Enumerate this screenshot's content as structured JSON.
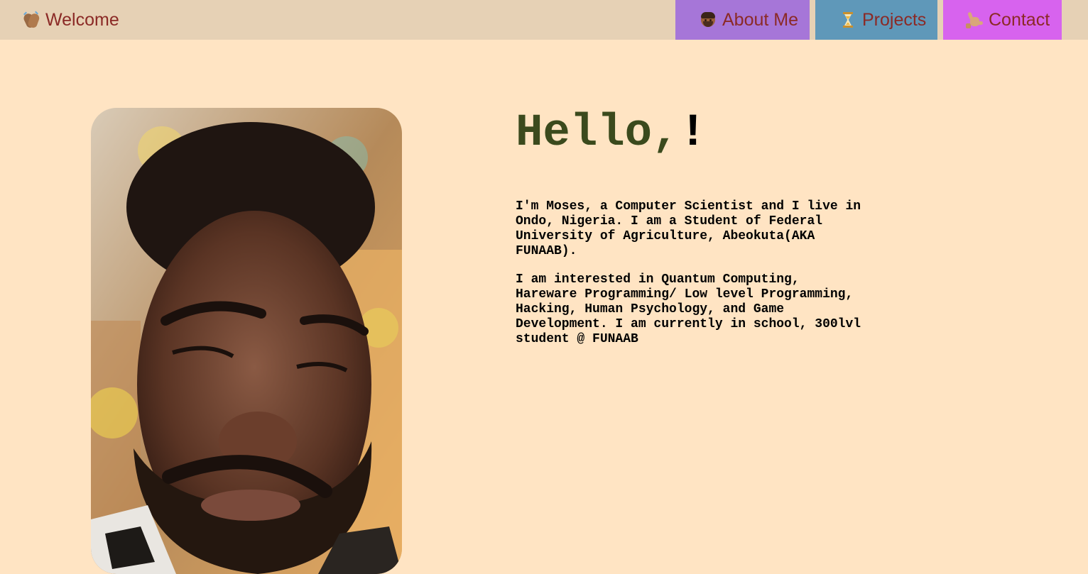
{
  "navbar": {
    "brand": {
      "icon": "clapping-hands-icon",
      "label": "Welcome"
    },
    "links": [
      {
        "icon": "person-beard-icon",
        "label": "About Me",
        "background": "#a676d8"
      },
      {
        "icon": "hourglass-icon",
        "label": "Projects",
        "background": "#5f98b9"
      },
      {
        "icon": "call-me-hand-icon",
        "label": "Contact",
        "background": "#d763ee"
      }
    ],
    "background": "#e6d1b5",
    "text_color": "#8b2a26"
  },
  "hero": {
    "greeting": "Hello,",
    "greeting_mark": "!",
    "greeting_color": "#3b4a1d",
    "paragraphs": [
      "I'm Moses, a Computer Scientist and I live in Ondo, Nigeria. I am a Student of Federal University of Agriculture, Abeokuta(AKA FUNAAB).",
      "I am interested in Quantum Computing, Hareware Programming/ Low level Programming, Hacking, Human Psychology, and Game Development. I am currently in school, 300lvl student @ FUNAAB"
    ]
  },
  "page": {
    "background": "#ffe4c3"
  }
}
